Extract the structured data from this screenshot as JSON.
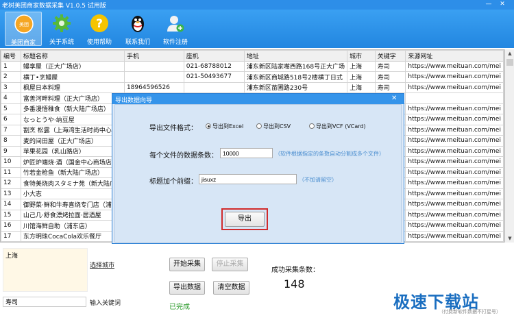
{
  "window": {
    "title": "老树美团商家数据采集 V1.0.5 试用版",
    "min": "—",
    "close": "✕"
  },
  "toolbar": {
    "items": [
      {
        "label": "美团商家",
        "icon": "meituan-logo-icon",
        "color": "#f5a623"
      },
      {
        "label": "关于系统",
        "icon": "gear-icon",
        "color": "#56b83a"
      },
      {
        "label": "使用帮助",
        "icon": "question-icon",
        "color": "#f5c400"
      },
      {
        "label": "联系我们",
        "icon": "qq-penguin-icon",
        "color": "#111111"
      },
      {
        "label": "软件注册",
        "icon": "user-add-icon",
        "color": "#e8e8e8"
      }
    ]
  },
  "table": {
    "columns": [
      "编号",
      "标题名称",
      "手机",
      "座机",
      "地址",
      "城市",
      "关键字",
      "来源网址"
    ],
    "rows": [
      [
        "1",
        "鳗享屋（正大广场店）",
        "",
        "021-68788012",
        "浦东新区陆家嘴西路168号正大广场",
        "上海",
        "寿司",
        "https://www.meituan.com/mei"
      ],
      [
        "2",
        "横丁•烹鳗屋",
        "",
        "021-50493677",
        "浦东新区商城路518号2楼横丁日式",
        "上海",
        "寿司",
        "https://www.meituan.com/mei"
      ],
      [
        "3",
        "枫屋日本料理",
        "18964596526",
        "",
        "浦东新区苗圃路230号",
        "上海",
        "寿司",
        "https://www.meituan.com/mei"
      ],
      [
        "4",
        "富善河畔料理（正大广场店）",
        "",
        "",
        "",
        "",
        "",
        ""
      ],
      [
        "5",
        "多番漫悟稚食（新大陆广场店）",
        "",
        "",
        "",
        "",
        "",
        "https://www.meituan.com/mei"
      ],
      [
        "6",
        "なっとうや·纳豆屋",
        "",
        "",
        "",
        "",
        "",
        "https://www.meituan.com/mei"
      ],
      [
        "7",
        "割烹 松露（上海湾生活时尚中心",
        "",
        "",
        "",
        "",
        "",
        "https://www.meituan.com/mei"
      ],
      [
        "8",
        "麦的间田屋（正大广场店）",
        "",
        "",
        "",
        "",
        "",
        "https://www.meituan.com/mei"
      ],
      [
        "9",
        "苹果花园（乳山路店）",
        "",
        "",
        "",
        "",
        "",
        "https://www.meituan.com/mei"
      ],
      [
        "10",
        "炉匠炉端烧·酒（国金中心商场店）",
        "",
        "",
        "",
        "",
        "",
        "https://www.meituan.com/mei"
      ],
      [
        "11",
        "竹若金枪鱼（新大陆广场店）",
        "",
        "",
        "",
        "",
        "",
        "https://www.meituan.com/mei"
      ],
      [
        "12",
        "食特美烧肉スタミナ苑（新大陆广场",
        "",
        "",
        "",
        "",
        "",
        "https://www.meituan.com/mei"
      ],
      [
        "13",
        "小大志",
        "",
        "",
        "",
        "",
        "",
        "https://www.meituan.com/mei"
      ],
      [
        "14",
        "御野菜·鲜和牛寿喜烧专门店（浦东",
        "",
        "",
        "",
        "",
        "",
        "https://www.meituan.com/mei"
      ],
      [
        "15",
        "山己几·舒食漂烤拉面·居酒屋",
        "",
        "",
        "",
        "",
        "",
        "https://www.meituan.com/mei"
      ],
      [
        "16",
        "川馆海鲜自助（浦东店）",
        "",
        "",
        "",
        "",
        "",
        "https://www.meituan.com/mei"
      ],
      [
        "17",
        "东方明珠CocaCola欢乐餐厅",
        "",
        "",
        "",
        "",
        "",
        "https://www.meituan.com/mei"
      ],
      [
        "18",
        "五月罗马海鲜自助餐厅（陆家嘴店",
        "",
        "",
        "",
        "",
        "",
        "https://www.meituan.com/mei"
      ]
    ]
  },
  "dialog": {
    "title": "导出数据向导",
    "close": "✕",
    "format_label": "导出文件格式：",
    "formats": [
      "导出到Excel",
      "导出到CSV",
      "导出到VCF (VCard)"
    ],
    "selected_format": "导出到Excel",
    "per_file_label": "每个文件的数据条数：",
    "per_file_value": "10000",
    "per_file_hint": "（软件根据指定的条数自动分割成多个文件）",
    "prefix_label": "标题加个前缀：",
    "prefix_value": "jisuxz",
    "prefix_hint": "（不加请留空）",
    "export_button": "导出"
  },
  "bottom": {
    "city_value": "上海",
    "select_city": "选择城市",
    "keyword_value": "寿司",
    "keyword_label": "输入关键词",
    "start_button": "开始采集",
    "stop_button": "停止采集",
    "export_button": "导出数据",
    "clear_button": "清空数据",
    "status": "已完成",
    "count_label": "成功采集条数：",
    "count_value": "148"
  },
  "watermark": {
    "text": "极速下载站",
    "sub": "（付费新软件数据不打星号）"
  }
}
